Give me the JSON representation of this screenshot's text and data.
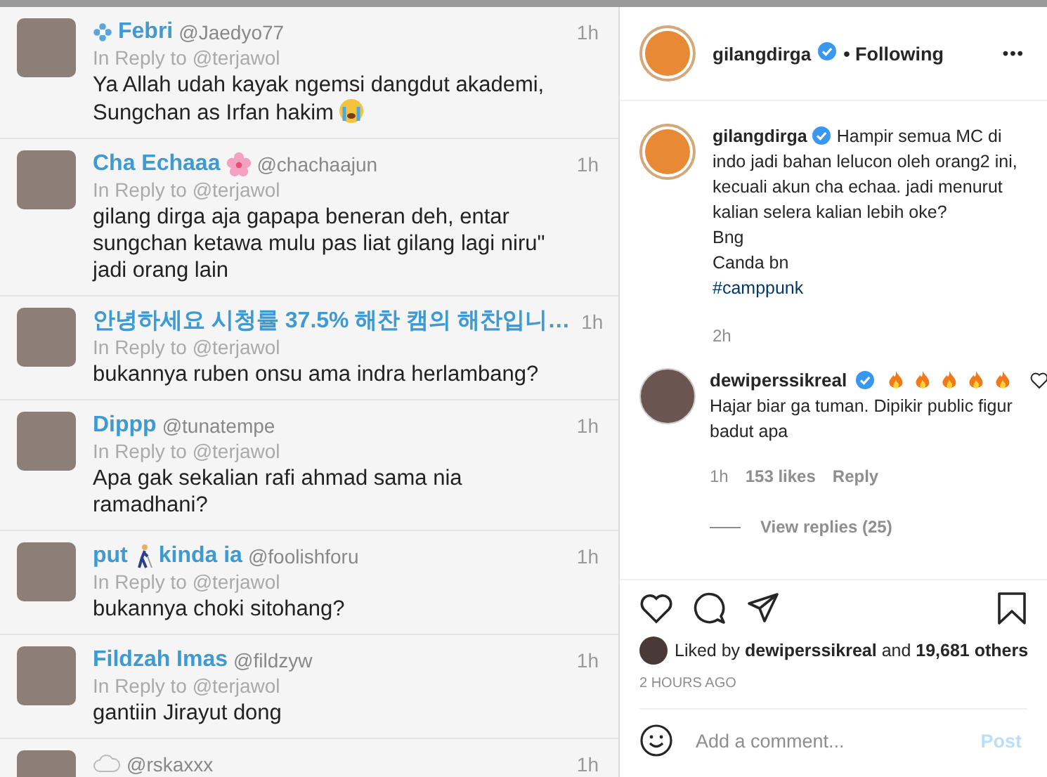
{
  "tweets": [
    {
      "name_parts": [
        {
          "kind": "sparkle"
        },
        {
          "kind": "text",
          "text": "Febri"
        }
      ],
      "handle": "@Jaedyo77",
      "time": "1h",
      "reply_to": "In Reply to @terjawol",
      "body": "Ya Allah udah kayak ngemsi dangdut akademi, Sungchan as Irfan hakim",
      "body_emoji": {
        "kind": "crying"
      }
    },
    {
      "name_parts": [
        {
          "kind": "text",
          "text": "Cha Echaaa"
        },
        {
          "kind": "flower"
        }
      ],
      "handle": "@chachaajun",
      "time": "1h",
      "reply_to": "In Reply to @terjawol",
      "body": "gilang dirga aja gapapa beneran deh, entar sungchan ketawa mulu pas liat gilang lagi niru\" jadi orang lain"
    },
    {
      "name_parts": [
        {
          "kind": "text",
          "text": "안녕하세요 시청률 37.5% 해찬 캠의 해찬입니…"
        }
      ],
      "time": "1h",
      "reply_to": "In Reply to @terjawol",
      "body": "bukannya ruben onsu ama indra herlambang?"
    },
    {
      "name_parts": [
        {
          "kind": "text",
          "text": "Dippp"
        }
      ],
      "handle": "@tunatempe",
      "time": "1h",
      "reply_to": "In Reply to @terjawol",
      "body": "Apa gak sekalian rafi ahmad sama nia ramadhani?"
    },
    {
      "name_parts": [
        {
          "kind": "text",
          "text": "put"
        },
        {
          "kind": "walker"
        },
        {
          "kind": "text",
          "text": "kinda ia"
        }
      ],
      "handle": "@foolishforu",
      "time": "1h",
      "reply_to": "In Reply to @terjawol",
      "body": "bukannya choki sitohang?"
    },
    {
      "name_parts": [
        {
          "kind": "text",
          "text": "Fildzah Imas"
        }
      ],
      "handle": "@fildzyw",
      "time": "1h",
      "reply_to": "In Reply to @terjawol",
      "body": "gantiin Jirayut dong"
    },
    {
      "name_parts": [
        {
          "kind": "cloud"
        }
      ],
      "handle": "@rskaxxx",
      "time": "1h"
    }
  ],
  "post": {
    "username": "gilangdirga",
    "verified": true,
    "follow_status": "• Following",
    "more": "•••",
    "caption": {
      "username": "gilangdirga",
      "verified": true,
      "lines": [
        "Hampir semua MC di indo jadi bahan lelucon oleh orang2 ini, kecuali akun cha echaa. jadi menurut kalian selera kalian lebih oke?",
        "Bng",
        "Canda bn"
      ],
      "hashtag": "#camppunk",
      "time": "2h"
    },
    "comment": {
      "username": "dewiperssikreal",
      "verified": true,
      "reactions": [
        {
          "kind": "fire"
        },
        {
          "kind": "fire"
        },
        {
          "kind": "fire"
        },
        {
          "kind": "fire"
        },
        {
          "kind": "fire"
        }
      ],
      "liked": false,
      "text": "Hajar biar ga tuman. Dipikir public figur badut apa",
      "time": "1h",
      "likes": "153 likes",
      "reply": "Reply",
      "view_replies": "View replies (25)"
    },
    "liked": false,
    "saved": false,
    "liked_by": "Liked by **dewiperssikreal** and **19,681 others**",
    "age": "2 HOURS AGO",
    "comment_field": {
      "placeholder": "Add a comment..."
    },
    "post_button": {
      "label": "Post",
      "disabled": true
    }
  }
}
